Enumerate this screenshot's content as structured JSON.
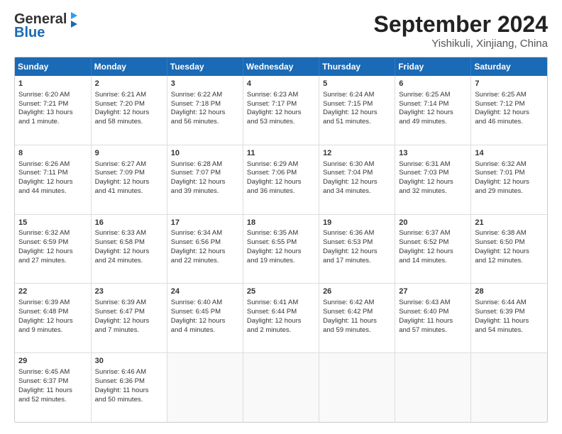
{
  "header": {
    "logo_line1": "General",
    "logo_line2": "Blue",
    "title": "September 2024",
    "subtitle": "Yishikuli, Xinjiang, China"
  },
  "weekdays": [
    "Sunday",
    "Monday",
    "Tuesday",
    "Wednesday",
    "Thursday",
    "Friday",
    "Saturday"
  ],
  "weeks": [
    [
      {
        "day": "1",
        "info": "Sunrise: 6:20 AM\nSunset: 7:21 PM\nDaylight: 13 hours\nand 1 minute."
      },
      {
        "day": "2",
        "info": "Sunrise: 6:21 AM\nSunset: 7:20 PM\nDaylight: 12 hours\nand 58 minutes."
      },
      {
        "day": "3",
        "info": "Sunrise: 6:22 AM\nSunset: 7:18 PM\nDaylight: 12 hours\nand 56 minutes."
      },
      {
        "day": "4",
        "info": "Sunrise: 6:23 AM\nSunset: 7:17 PM\nDaylight: 12 hours\nand 53 minutes."
      },
      {
        "day": "5",
        "info": "Sunrise: 6:24 AM\nSunset: 7:15 PM\nDaylight: 12 hours\nand 51 minutes."
      },
      {
        "day": "6",
        "info": "Sunrise: 6:25 AM\nSunset: 7:14 PM\nDaylight: 12 hours\nand 49 minutes."
      },
      {
        "day": "7",
        "info": "Sunrise: 6:25 AM\nSunset: 7:12 PM\nDaylight: 12 hours\nand 46 minutes."
      }
    ],
    [
      {
        "day": "8",
        "info": "Sunrise: 6:26 AM\nSunset: 7:11 PM\nDaylight: 12 hours\nand 44 minutes."
      },
      {
        "day": "9",
        "info": "Sunrise: 6:27 AM\nSunset: 7:09 PM\nDaylight: 12 hours\nand 41 minutes."
      },
      {
        "day": "10",
        "info": "Sunrise: 6:28 AM\nSunset: 7:07 PM\nDaylight: 12 hours\nand 39 minutes."
      },
      {
        "day": "11",
        "info": "Sunrise: 6:29 AM\nSunset: 7:06 PM\nDaylight: 12 hours\nand 36 minutes."
      },
      {
        "day": "12",
        "info": "Sunrise: 6:30 AM\nSunset: 7:04 PM\nDaylight: 12 hours\nand 34 minutes."
      },
      {
        "day": "13",
        "info": "Sunrise: 6:31 AM\nSunset: 7:03 PM\nDaylight: 12 hours\nand 32 minutes."
      },
      {
        "day": "14",
        "info": "Sunrise: 6:32 AM\nSunset: 7:01 PM\nDaylight: 12 hours\nand 29 minutes."
      }
    ],
    [
      {
        "day": "15",
        "info": "Sunrise: 6:32 AM\nSunset: 6:59 PM\nDaylight: 12 hours\nand 27 minutes."
      },
      {
        "day": "16",
        "info": "Sunrise: 6:33 AM\nSunset: 6:58 PM\nDaylight: 12 hours\nand 24 minutes."
      },
      {
        "day": "17",
        "info": "Sunrise: 6:34 AM\nSunset: 6:56 PM\nDaylight: 12 hours\nand 22 minutes."
      },
      {
        "day": "18",
        "info": "Sunrise: 6:35 AM\nSunset: 6:55 PM\nDaylight: 12 hours\nand 19 minutes."
      },
      {
        "day": "19",
        "info": "Sunrise: 6:36 AM\nSunset: 6:53 PM\nDaylight: 12 hours\nand 17 minutes."
      },
      {
        "day": "20",
        "info": "Sunrise: 6:37 AM\nSunset: 6:52 PM\nDaylight: 12 hours\nand 14 minutes."
      },
      {
        "day": "21",
        "info": "Sunrise: 6:38 AM\nSunset: 6:50 PM\nDaylight: 12 hours\nand 12 minutes."
      }
    ],
    [
      {
        "day": "22",
        "info": "Sunrise: 6:39 AM\nSunset: 6:48 PM\nDaylight: 12 hours\nand 9 minutes."
      },
      {
        "day": "23",
        "info": "Sunrise: 6:39 AM\nSunset: 6:47 PM\nDaylight: 12 hours\nand 7 minutes."
      },
      {
        "day": "24",
        "info": "Sunrise: 6:40 AM\nSunset: 6:45 PM\nDaylight: 12 hours\nand 4 minutes."
      },
      {
        "day": "25",
        "info": "Sunrise: 6:41 AM\nSunset: 6:44 PM\nDaylight: 12 hours\nand 2 minutes."
      },
      {
        "day": "26",
        "info": "Sunrise: 6:42 AM\nSunset: 6:42 PM\nDaylight: 11 hours\nand 59 minutes."
      },
      {
        "day": "27",
        "info": "Sunrise: 6:43 AM\nSunset: 6:40 PM\nDaylight: 11 hours\nand 57 minutes."
      },
      {
        "day": "28",
        "info": "Sunrise: 6:44 AM\nSunset: 6:39 PM\nDaylight: 11 hours\nand 54 minutes."
      }
    ],
    [
      {
        "day": "29",
        "info": "Sunrise: 6:45 AM\nSunset: 6:37 PM\nDaylight: 11 hours\nand 52 minutes."
      },
      {
        "day": "30",
        "info": "Sunrise: 6:46 AM\nSunset: 6:36 PM\nDaylight: 11 hours\nand 50 minutes."
      },
      {
        "day": "",
        "info": ""
      },
      {
        "day": "",
        "info": ""
      },
      {
        "day": "",
        "info": ""
      },
      {
        "day": "",
        "info": ""
      },
      {
        "day": "",
        "info": ""
      }
    ]
  ]
}
